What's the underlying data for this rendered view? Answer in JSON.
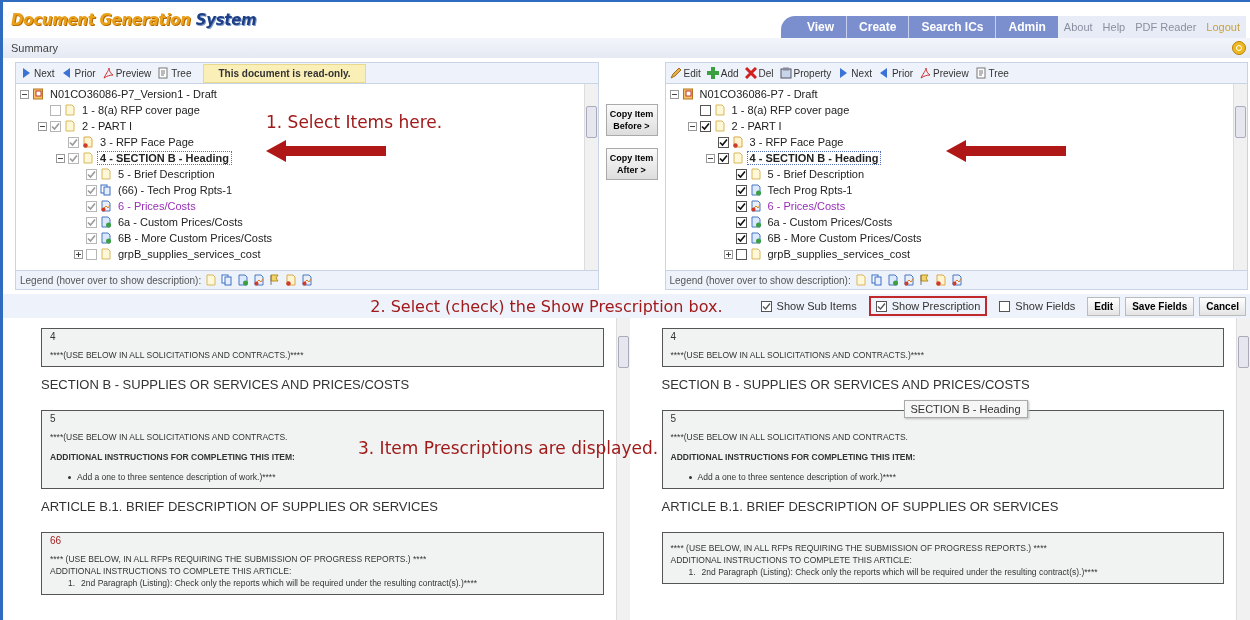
{
  "header": {
    "logo": {
      "brand": "Document Generation",
      "product": "System"
    },
    "nav_tabs": [
      "View",
      "Create",
      "Search ICs",
      "Admin"
    ],
    "links": [
      {
        "label": "About",
        "disabled": false
      },
      {
        "label": "Help",
        "disabled": false
      },
      {
        "label": "PDF Reader",
        "disabled": false
      },
      {
        "label": "Logout",
        "disabled": true
      }
    ]
  },
  "summary_bar": {
    "title": "Summary"
  },
  "left_tree": {
    "readonly": true,
    "toolbar": [
      {
        "kind": "next",
        "label": "Next"
      },
      {
        "kind": "prior",
        "label": "Prior"
      },
      {
        "kind": "preview",
        "label": "Preview"
      },
      {
        "kind": "tree",
        "label": "Tree"
      }
    ],
    "notice": "This document is read-only.",
    "legend": "Legend (hover over to show description):",
    "annotation": "1. Select Items here.",
    "root": {
      "label": "N01CO36086-P7_Version1 - Draft",
      "expanded": true,
      "children": [
        {
          "label": "1 - 8(a) RFP cover page",
          "kind": "doc",
          "checked": false,
          "selected": false
        },
        {
          "label": "2 - PART I",
          "kind": "doc",
          "checked": true,
          "selected": false,
          "expanded": true,
          "children": [
            {
              "label": "3 - RFP Face Page",
              "kind": "required",
              "checked": true,
              "selected": false
            },
            {
              "label": "4 - SECTION B - Heading",
              "kind": "doc",
              "checked": true,
              "selected": true,
              "expanded": true,
              "children": [
                {
                  "label": "5 - Brief Description",
                  "kind": "doc",
                  "checked": true,
                  "selected": false
                },
                {
                  "label": "(66) - Tech Prog Rpts-1",
                  "kind": "copy",
                  "checked": true,
                  "selected": false
                },
                {
                  "label": "6 - Prices/Costs",
                  "kind": "priced",
                  "checked": true,
                  "selected": false,
                  "visited": true
                },
                {
                  "label": "6a - Custom Prices/Costs",
                  "kind": "custom",
                  "checked": true,
                  "selected": false
                },
                {
                  "label": "6B - More Custom Prices/Costs",
                  "kind": "custom",
                  "checked": true,
                  "selected": false
                },
                {
                  "label": "grpB_supplies_services_cost",
                  "kind": "doc",
                  "checked": false,
                  "selected": false,
                  "expanded": false
                }
              ]
            }
          ]
        }
      ]
    }
  },
  "copy_buttons": [
    [
      "Copy Item",
      "Before >"
    ],
    [
      "Copy Item",
      "After >"
    ]
  ],
  "right_tree": {
    "readonly": false,
    "toolbar": [
      {
        "kind": "edit",
        "label": "Edit"
      },
      {
        "kind": "add",
        "label": "Add"
      },
      {
        "kind": "del",
        "label": "Del"
      },
      {
        "kind": "property",
        "label": "Property"
      },
      {
        "kind": "next",
        "label": "Next"
      },
      {
        "kind": "prior",
        "label": "Prior"
      },
      {
        "kind": "preview",
        "label": "Preview"
      },
      {
        "kind": "tree",
        "label": "Tree"
      }
    ],
    "legend": "Legend (hover over to show description):",
    "root": {
      "label": "N01CO36086-P7 - Draft",
      "expanded": true,
      "children": [
        {
          "label": "1 - 8(a) RFP cover page",
          "kind": "doc",
          "checked": false,
          "selected": false
        },
        {
          "label": "2 - PART I",
          "kind": "doc",
          "checked": true,
          "selected": false,
          "expanded": true,
          "children": [
            {
              "label": "3 - RFP Face Page",
              "kind": "required",
              "checked": true,
              "selected": false
            },
            {
              "label": "4 - SECTION B - Heading",
              "kind": "doc",
              "checked": true,
              "selected": true,
              "expanded": true,
              "children": [
                {
                  "label": "5 - Brief Description",
                  "kind": "doc",
                  "checked": true,
                  "selected": false
                },
                {
                  "label": "Tech Prog Rpts-1",
                  "kind": "custom",
                  "checked": true,
                  "selected": false
                },
                {
                  "label": "6 - Prices/Costs",
                  "kind": "priced",
                  "checked": true,
                  "selected": false,
                  "visited": true
                },
                {
                  "label": "6a - Custom Prices/Costs",
                  "kind": "custom",
                  "checked": true,
                  "selected": false
                },
                {
                  "label": "6B - More Custom Prices/Costs",
                  "kind": "custom",
                  "checked": true,
                  "selected": false
                },
                {
                  "label": "grpB_supplies_services_cost",
                  "kind": "doc",
                  "checked": false,
                  "selected": false,
                  "expanded": false
                }
              ]
            }
          ]
        }
      ]
    }
  },
  "options_bar": {
    "annotation": "2. Select (check) the Show Prescription box.",
    "options": [
      {
        "label": "Show Sub Items",
        "checked": true,
        "highlighted": false
      },
      {
        "label": "Show Prescription",
        "checked": true,
        "highlighted": true
      },
      {
        "label": "Show Fields",
        "checked": false,
        "highlighted": false
      }
    ],
    "buttons": [
      "Edit",
      "Save Fields",
      "Cancel"
    ]
  },
  "left_pane": {
    "annotation": "3. Item Prescriptions are displayed.",
    "blocks": [
      {
        "kind": "prescription",
        "number": "4",
        "number_flagged": false,
        "lines": [
          {
            "kind": "text",
            "text": "****(USE BELOW IN ALL SOLICITATIONS AND CONTRACTS.)****"
          }
        ]
      },
      {
        "kind": "heading",
        "text": "SECTION B - SUPPLIES OR SERVICES AND PRICES/COSTS"
      },
      {
        "kind": "prescription",
        "number": "5",
        "number_flagged": false,
        "lines": [
          {
            "kind": "text",
            "text": "****(USE BELOW IN ALL SOLICITATIONS AND CONTRACTS."
          },
          {
            "kind": "bold",
            "text": "ADDITIONAL INSTRUCTIONS FOR COMPLETING THIS ITEM:"
          },
          {
            "kind": "bullet",
            "text": "Add a one to three sentence description of work.)****"
          }
        ]
      },
      {
        "kind": "heading",
        "text": "ARTICLE B.1. BRIEF DESCRIPTION OF SUPPLIES OR SERVICES"
      },
      {
        "kind": "prescription",
        "number": "66",
        "number_flagged": true,
        "lines": [
          {
            "kind": "plain",
            "text": "**** (USE BELOW, IN ALL RFPs REQUIRING THE SUBMISSION OF PROGRESS REPORTS.) ****"
          },
          {
            "kind": "plain",
            "text": "ADDITIONAL INSTRUCTIONS TO COMPLETE THIS ARTICLE:"
          },
          {
            "kind": "numbered",
            "marker": "1.",
            "text": "2nd Paragraph (Listing): Check only the reports which will be required under the resulting contract(s).)****"
          }
        ]
      }
    ]
  },
  "right_pane": {
    "tooltip": "SECTION B - Heading",
    "blocks": [
      {
        "kind": "prescription",
        "number": "4",
        "number_flagged": false,
        "lines": [
          {
            "kind": "text",
            "text": "****(USE BELOW IN ALL SOLICITATIONS AND CONTRACTS.)****"
          }
        ]
      },
      {
        "kind": "heading",
        "text": "SECTION B - SUPPLIES OR SERVICES AND PRICES/COSTS"
      },
      {
        "kind": "prescription",
        "number": "5",
        "number_flagged": false,
        "lines": [
          {
            "kind": "text",
            "text": "****(USE BELOW IN ALL SOLICITATIONS AND CONTRACTS."
          },
          {
            "kind": "bold",
            "text": "ADDITIONAL INSTRUCTIONS FOR COMPLETING THIS ITEM:"
          },
          {
            "kind": "bullet",
            "text": "Add a one to three sentence description of work.)****"
          }
        ]
      },
      {
        "kind": "heading",
        "text": "ARTICLE B.1. BRIEF DESCRIPTION OF SUPPLIES OR SERVICES"
      },
      {
        "kind": "prescription",
        "lines": [
          {
            "kind": "plain",
            "text": "**** (USE BELOW, IN ALL RFPs REQUIRING THE SUBMISSION OF PROGRESS REPORTS.) ****"
          },
          {
            "kind": "plain",
            "text": "ADDITIONAL INSTRUCTIONS TO COMPLETE THIS ARTICLE:"
          },
          {
            "kind": "numbered",
            "marker": "1.",
            "text": "2nd Paragraph (Listing): Check only the reports which will be required under the resulting contract(s).)****"
          }
        ]
      }
    ]
  }
}
